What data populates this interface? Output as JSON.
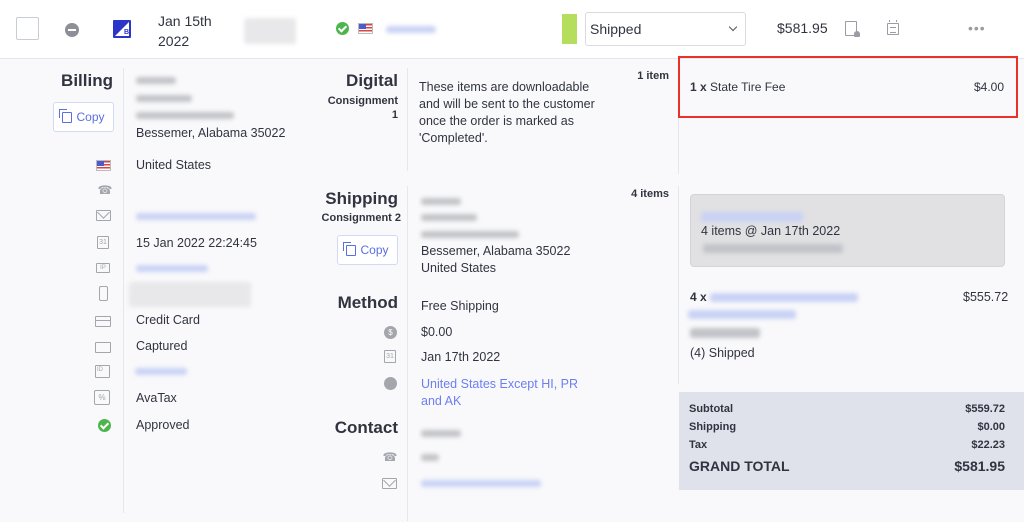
{
  "order_row": {
    "date_line1": "Jan 15th",
    "date_line2": "2022",
    "status": "Shipped",
    "status_color": "#b5de5c",
    "total": "$581.95",
    "channel_icon_letter": "B"
  },
  "billing": {
    "heading": "Billing",
    "copy_label": "Copy",
    "city_line": "Bessemer, Alabama 35022",
    "country": "United States",
    "order_datetime": "15 Jan 2022 22:24:45",
    "payment_method": "Credit Card",
    "payment_status": "Captured",
    "tax_provider": "AvaTax",
    "fraud_status": "Approved"
  },
  "digital": {
    "heading": "Digital",
    "sub_line1": "Consignment",
    "sub_line2": "1",
    "message_lines": [
      "These items are downloadable",
      "and will be sent to the customer",
      "once the order is marked as",
      "'Completed'."
    ],
    "count": "1 item",
    "items": [
      {
        "qty": "1 x",
        "name": "State Tire Fee",
        "price": "$4.00"
      }
    ]
  },
  "shipping": {
    "heading": "Shipping",
    "sub": "Consignment 2",
    "copy_label": "Copy",
    "city_line": "Bessemer, Alabama 35022",
    "country": "United States",
    "count": "4 items",
    "shipment_summary": "4 items @ Jan 17th 2022",
    "items": [
      {
        "qty": "4 x",
        "price": "$555.72",
        "status": "(4) Shipped"
      }
    ]
  },
  "method": {
    "heading": "Method",
    "name": "Free Shipping",
    "cost": "$0.00",
    "date": "Jan 17th 2022",
    "zone_line1": "United States Except HI, PR",
    "zone_line2": "and AK"
  },
  "contact": {
    "heading": "Contact"
  },
  "totals": {
    "subtotal_label": "Subtotal",
    "subtotal": "$559.72",
    "shipping_label": "Shipping",
    "shipping": "$0.00",
    "tax_label": "Tax",
    "tax": "$22.23",
    "grand_label": "GRAND TOTAL",
    "grand": "$581.95"
  },
  "icons": {
    "calendar_day": "31",
    "ip_label": "IP",
    "id_label": "ID",
    "tax_label": "%",
    "dollar_label": "$",
    "more": "•••"
  }
}
